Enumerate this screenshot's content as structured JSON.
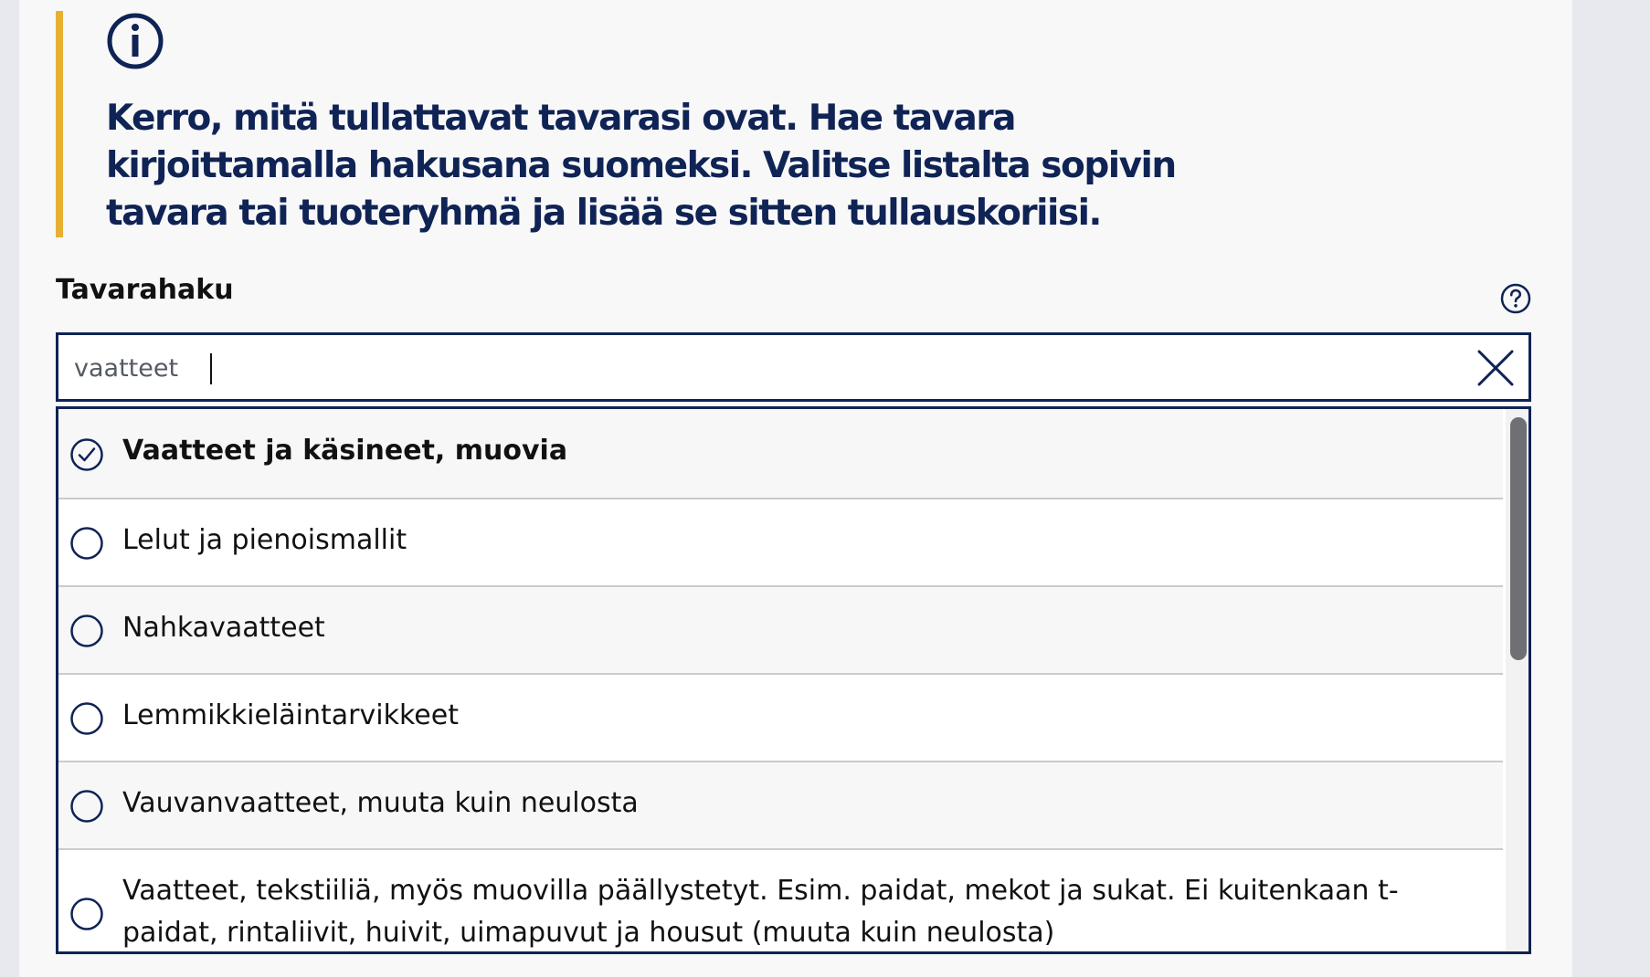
{
  "info": {
    "icon": "info-icon",
    "text": "Kerro, mitä tullattavat tavarasi ovat. Hae tavara kirjoittamalla hakusana suomeksi. Valitse listalta sopivin tavara tai tuoteryhmä ja lisää se sitten tullauskoriisi.",
    "accent_color": "#e8b030",
    "text_color": "#0f2355"
  },
  "search": {
    "label": "Tavarahaku",
    "value": "vaatteet",
    "help_icon": "question-circle-icon",
    "clear_icon": "close-icon"
  },
  "results": {
    "options": [
      {
        "label": "Vaatteet ja käsineet, muovia",
        "selected": true
      },
      {
        "label": "Lelut ja pienoismallit",
        "selected": false
      },
      {
        "label": "Nahkavaatteet",
        "selected": false
      },
      {
        "label": "Lemmikkieläintarvikkeet",
        "selected": false
      },
      {
        "label": "Vauvanvaatteet, muuta kuin neulosta",
        "selected": false
      },
      {
        "label": "Vaatteet, tekstiiliä, myös muovilla päällystetyt. Esim. paidat, mekot ja sukat. Ei kuitenkaan t-paidat, rintaliivit, huivit, uimapuvut ja housut (muuta kuin neulosta)",
        "selected": false
      }
    ]
  },
  "colors": {
    "navy": "#0f2355",
    "divider": "#c9cbd0",
    "scrollbar_thumb": "#6f7073"
  }
}
